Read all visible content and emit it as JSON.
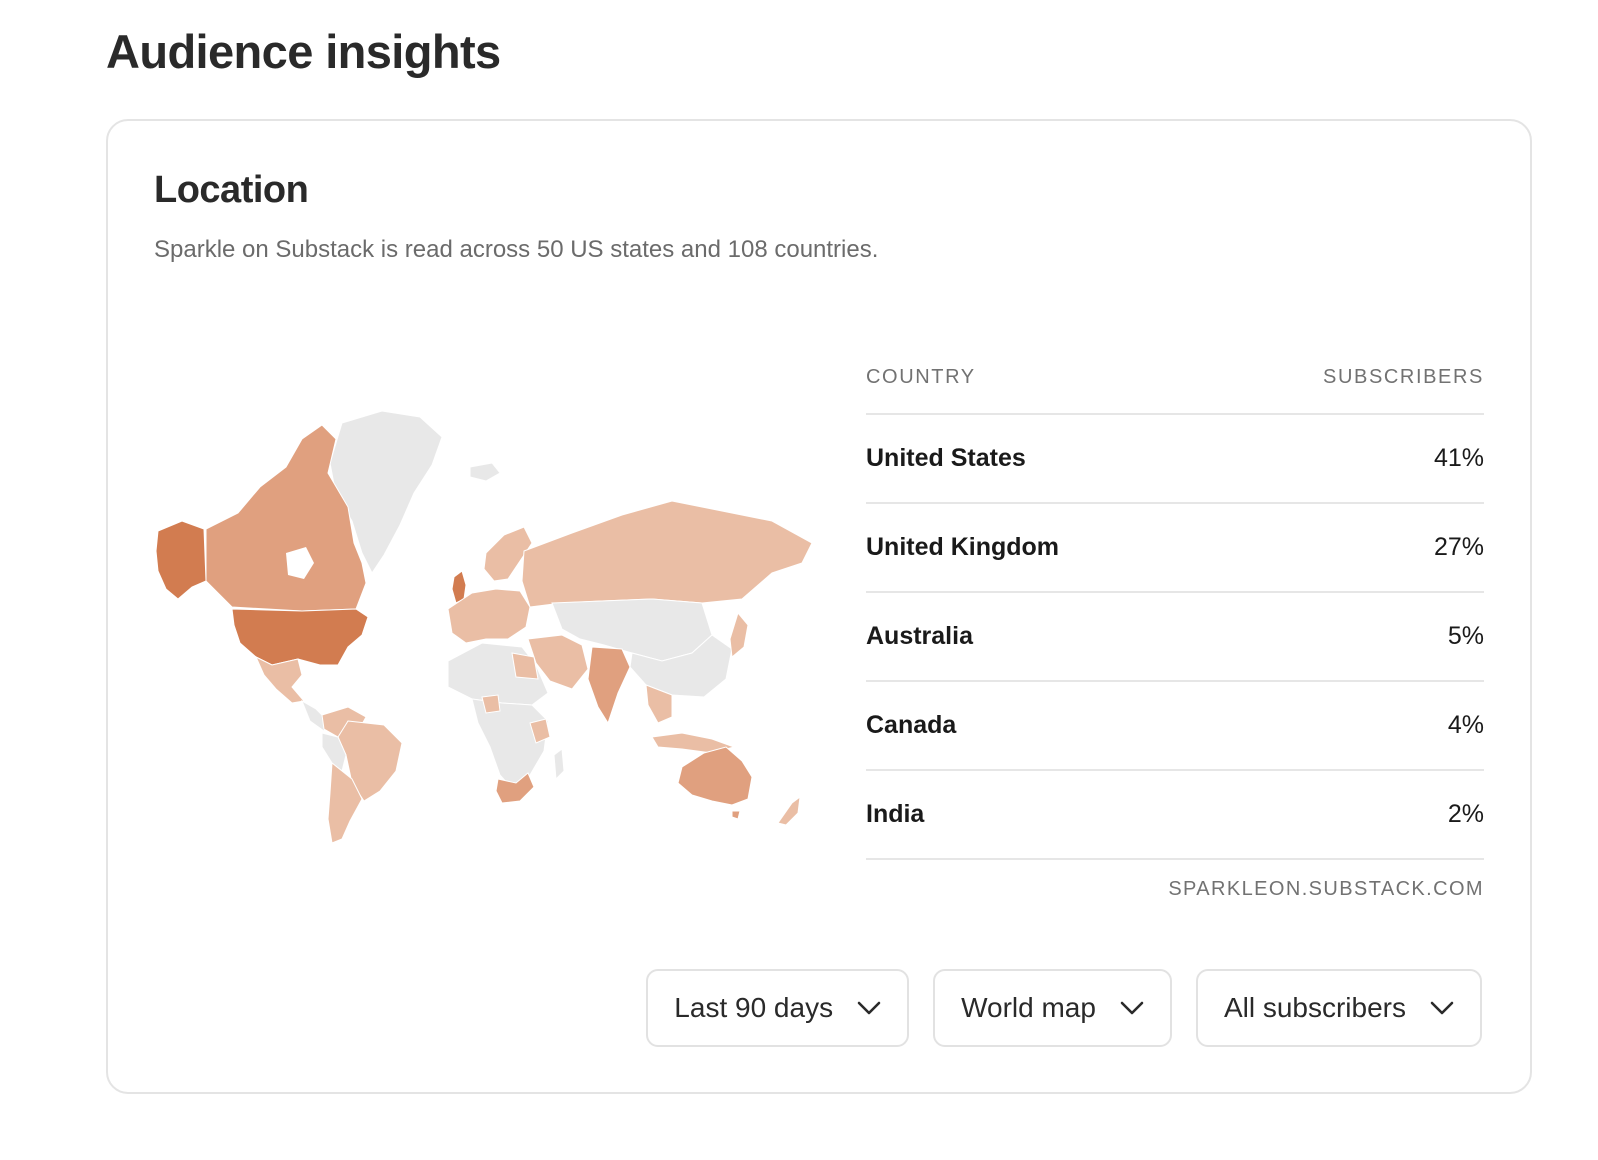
{
  "page": {
    "title": "Audience insights"
  },
  "location": {
    "title": "Location",
    "subtitle": "Sparkle on Substack is read across 50 US states and 108 countries."
  },
  "map": {
    "colors": {
      "high": "#d27c50",
      "medium": "#e0a07f",
      "low": "#eabea5",
      "none": "#e8e8e8"
    }
  },
  "table": {
    "headers": {
      "country": "COUNTRY",
      "subscribers": "SUBSCRIBERS"
    },
    "rows": [
      {
        "country": "United States",
        "pct": "41%"
      },
      {
        "country": "United Kingdom",
        "pct": "27%"
      },
      {
        "country": "Australia",
        "pct": "5%"
      },
      {
        "country": "Canada",
        "pct": "4%"
      },
      {
        "country": "India",
        "pct": "2%"
      }
    ],
    "source": "SPARKLEON.SUBSTACK.COM"
  },
  "filters": {
    "period": {
      "label": "Last 90 days",
      "icon": "chevron-down-icon"
    },
    "view": {
      "label": "World map",
      "icon": "chevron-down-icon"
    },
    "audience": {
      "label": "All subscribers",
      "icon": "chevron-down-icon"
    }
  }
}
